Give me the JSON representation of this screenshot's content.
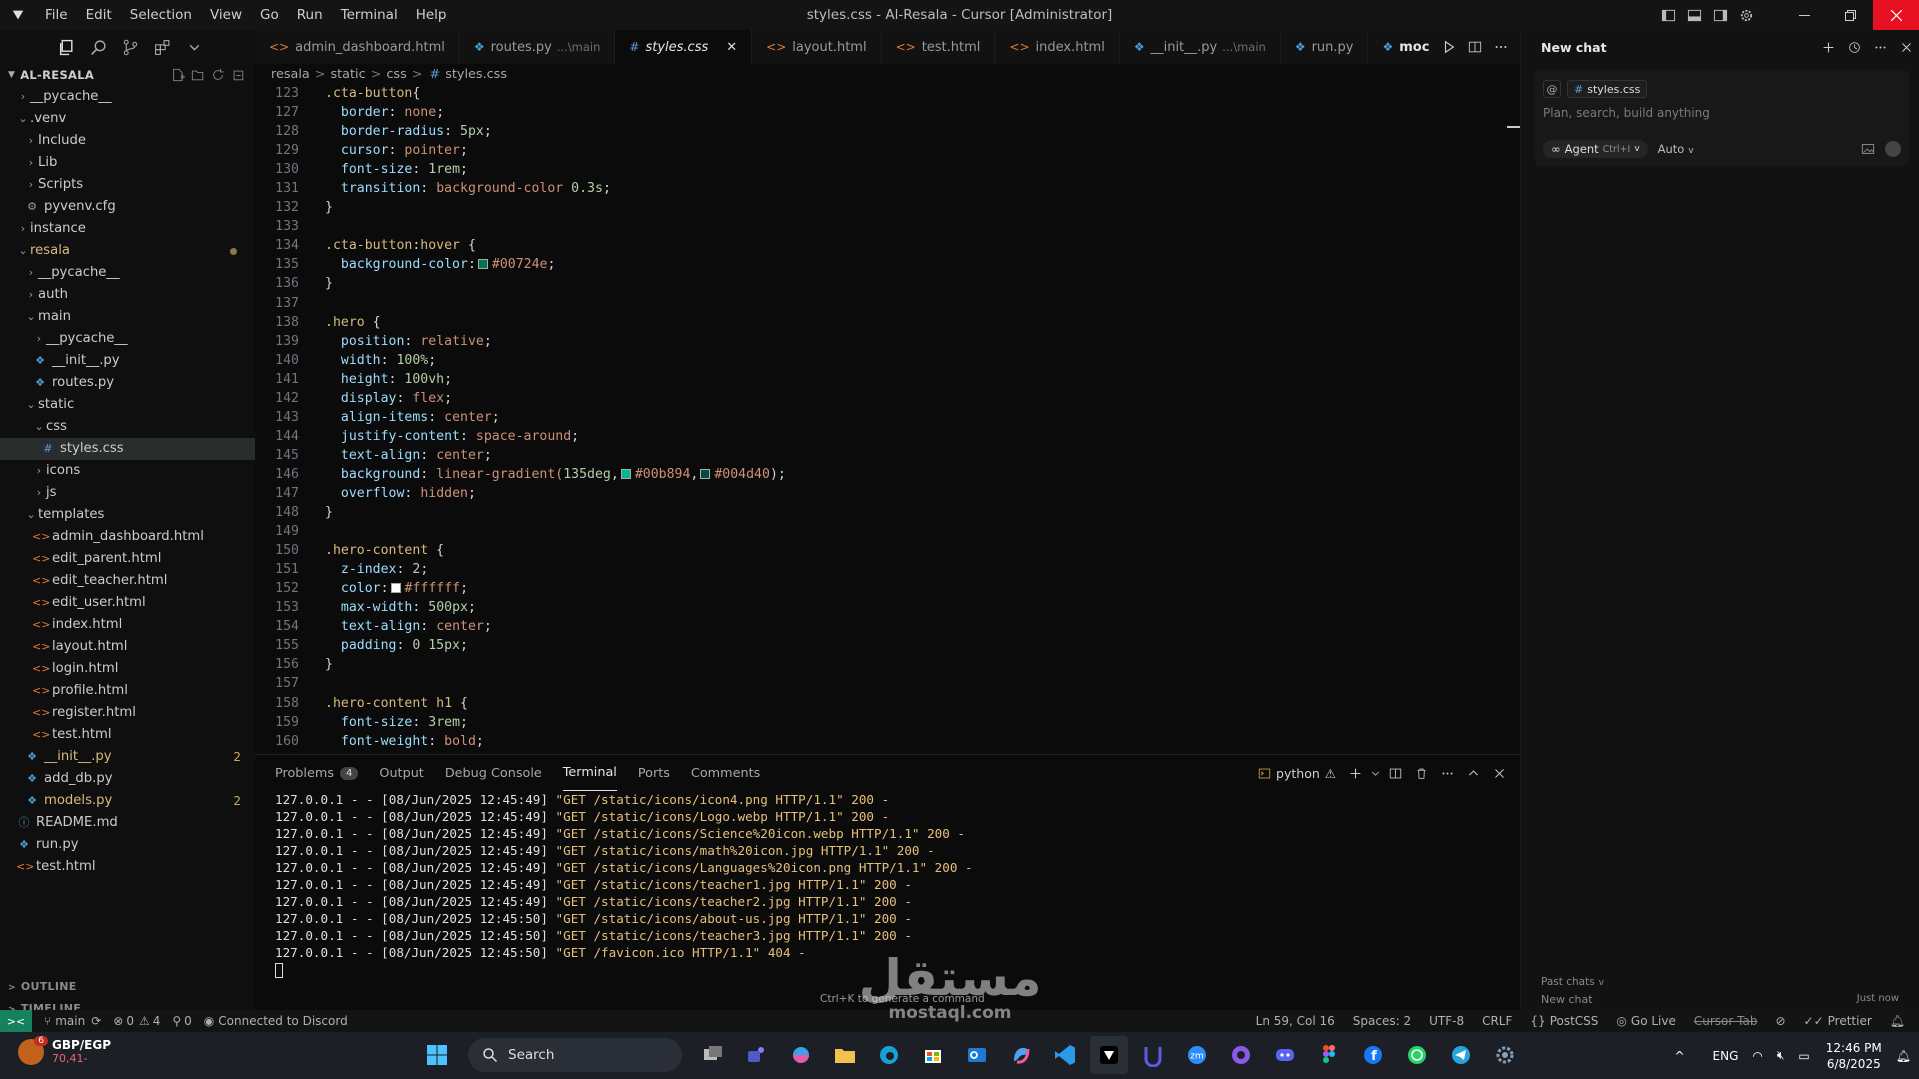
{
  "window": {
    "title": "styles.css - Al-Resala - Cursor [Administrator]"
  },
  "menu": [
    "File",
    "Edit",
    "Selection",
    "View",
    "Go",
    "Run",
    "Terminal",
    "Help"
  ],
  "explorer": {
    "root": "AL-RESALA",
    "items": [
      {
        "label": "__pycache__",
        "depth": 1,
        "kind": "folder",
        "open": false
      },
      {
        "label": ".venv",
        "depth": 1,
        "kind": "folder",
        "open": true
      },
      {
        "label": "Include",
        "depth": 2,
        "kind": "folder",
        "open": false
      },
      {
        "label": "Lib",
        "depth": 2,
        "kind": "folder",
        "open": false
      },
      {
        "label": "Scripts",
        "depth": 2,
        "kind": "folder",
        "open": false
      },
      {
        "label": "pyvenv.cfg",
        "depth": 2,
        "kind": "cfg"
      },
      {
        "label": "instance",
        "depth": 1,
        "kind": "folder",
        "open": false
      },
      {
        "label": "resala",
        "depth": 1,
        "kind": "folder",
        "open": true,
        "color": "#d7ba7d",
        "dot": true
      },
      {
        "label": "__pycache__",
        "depth": 2,
        "kind": "folder",
        "open": false
      },
      {
        "label": "auth",
        "depth": 2,
        "kind": "folder",
        "open": false
      },
      {
        "label": "main",
        "depth": 2,
        "kind": "folder",
        "open": true
      },
      {
        "label": "__pycache__",
        "depth": 3,
        "kind": "folder",
        "open": false
      },
      {
        "label": "__init__.py",
        "depth": 3,
        "kind": "py"
      },
      {
        "label": "routes.py",
        "depth": 3,
        "kind": "py"
      },
      {
        "label": "static",
        "depth": 2,
        "kind": "folder",
        "open": true
      },
      {
        "label": "css",
        "depth": 3,
        "kind": "folder",
        "open": true
      },
      {
        "label": "styles.css",
        "depth": 4,
        "kind": "css",
        "active": true
      },
      {
        "label": "icons",
        "depth": 3,
        "kind": "folder",
        "open": false
      },
      {
        "label": "js",
        "depth": 3,
        "kind": "folder",
        "open": false
      },
      {
        "label": "templates",
        "depth": 2,
        "kind": "folder",
        "open": true
      },
      {
        "label": "admin_dashboard.html",
        "depth": 3,
        "kind": "html"
      },
      {
        "label": "edit_parent.html",
        "depth": 3,
        "kind": "html"
      },
      {
        "label": "edit_teacher.html",
        "depth": 3,
        "kind": "html"
      },
      {
        "label": "edit_user.html",
        "depth": 3,
        "kind": "html"
      },
      {
        "label": "index.html",
        "depth": 3,
        "kind": "html"
      },
      {
        "label": "layout.html",
        "depth": 3,
        "kind": "html"
      },
      {
        "label": "login.html",
        "depth": 3,
        "kind": "html"
      },
      {
        "label": "profile.html",
        "depth": 3,
        "kind": "html"
      },
      {
        "label": "register.html",
        "depth": 3,
        "kind": "html"
      },
      {
        "label": "test.html",
        "depth": 3,
        "kind": "html"
      },
      {
        "label": "__init__.py",
        "depth": 2,
        "kind": "py",
        "color": "#d7ba7d",
        "badge": "2"
      },
      {
        "label": "add_db.py",
        "depth": 2,
        "kind": "py"
      },
      {
        "label": "models.py",
        "depth": 2,
        "kind": "py",
        "color": "#d7ba7d",
        "badge": "2"
      },
      {
        "label": "README.md",
        "depth": 1,
        "kind": "md"
      },
      {
        "label": "run.py",
        "depth": 1,
        "kind": "py"
      },
      {
        "label": "test.html",
        "depth": 1,
        "kind": "html"
      }
    ],
    "outline": "OUTLINE",
    "timeline": "TIMELINE"
  },
  "tabs": [
    {
      "label": "admin_dashboard.html",
      "kind": "html",
      "sub": ""
    },
    {
      "label": "routes.py",
      "kind": "py",
      "sub": "...\\main"
    },
    {
      "label": "styles.css",
      "kind": "css",
      "sub": "",
      "active": true
    },
    {
      "label": "layout.html",
      "kind": "html",
      "sub": ""
    },
    {
      "label": "test.html",
      "kind": "html",
      "sub": ""
    },
    {
      "label": "index.html",
      "kind": "html",
      "sub": ""
    },
    {
      "label": "__init__.py",
      "kind": "py",
      "sub": "...\\main"
    },
    {
      "label": "run.py",
      "kind": "py",
      "sub": ""
    },
    {
      "label": "moc",
      "kind": "py",
      "sub": ""
    }
  ],
  "breadcrumb": [
    "resala",
    "static",
    "css",
    "styles.css"
  ],
  "code": [
    {
      "n": "123",
      "t": [
        [
          "sel",
          ".cta-button"
        ],
        [
          "",
          "{"
        ]
      ]
    },
    {
      "n": "127",
      "t": [
        [
          "",
          "  "
        ],
        [
          "prop",
          "border"
        ],
        [
          "",
          ": "
        ],
        [
          "val",
          "none"
        ],
        [
          "",
          ";"
        ]
      ]
    },
    {
      "n": "128",
      "t": [
        [
          "",
          "  "
        ],
        [
          "prop",
          "border-radius"
        ],
        [
          "",
          ": "
        ],
        [
          "num",
          "5px"
        ],
        [
          "",
          ";"
        ]
      ]
    },
    {
      "n": "129",
      "t": [
        [
          "",
          "  "
        ],
        [
          "prop",
          "cursor"
        ],
        [
          "",
          ": "
        ],
        [
          "val",
          "pointer"
        ],
        [
          "",
          ";"
        ]
      ]
    },
    {
      "n": "130",
      "t": [
        [
          "",
          "  "
        ],
        [
          "prop",
          "font-size"
        ],
        [
          "",
          ": "
        ],
        [
          "num",
          "1rem"
        ],
        [
          "",
          ";"
        ]
      ]
    },
    {
      "n": "131",
      "t": [
        [
          "",
          "  "
        ],
        [
          "prop",
          "transition"
        ],
        [
          "",
          ": "
        ],
        [
          "val",
          "background-color "
        ],
        [
          "num",
          "0.3s"
        ],
        [
          "",
          ";"
        ]
      ]
    },
    {
      "n": "132",
      "t": [
        [
          "",
          "}"
        ]
      ]
    },
    {
      "n": "133",
      "t": []
    },
    {
      "n": "134",
      "t": [
        [
          "sel",
          ".cta-button"
        ],
        [
          "",
          ":"
        ],
        [
          "sel",
          "hover"
        ],
        [
          "",
          " {"
        ]
      ]
    },
    {
      "n": "135",
      "t": [
        [
          "",
          "  "
        ],
        [
          "prop",
          "background-color"
        ],
        [
          "",
          ":"
        ],
        [
          "sw",
          "#00724e"
        ],
        [
          "val",
          "#00724e"
        ],
        [
          "",
          ";"
        ]
      ]
    },
    {
      "n": "136",
      "t": [
        [
          "",
          "}"
        ]
      ]
    },
    {
      "n": "137",
      "t": []
    },
    {
      "n": "138",
      "t": [
        [
          "sel",
          ".hero"
        ],
        [
          "",
          " {"
        ]
      ]
    },
    {
      "n": "139",
      "t": [
        [
          "",
          "  "
        ],
        [
          "prop",
          "position"
        ],
        [
          "",
          ": "
        ],
        [
          "val",
          "relative"
        ],
        [
          "",
          ";"
        ]
      ]
    },
    {
      "n": "140",
      "t": [
        [
          "",
          "  "
        ],
        [
          "prop",
          "width"
        ],
        [
          "",
          ": "
        ],
        [
          "num",
          "100%"
        ],
        [
          "",
          ";"
        ]
      ]
    },
    {
      "n": "141",
      "t": [
        [
          "",
          "  "
        ],
        [
          "prop",
          "height"
        ],
        [
          "",
          ": "
        ],
        [
          "num",
          "100vh"
        ],
        [
          "",
          ";"
        ]
      ]
    },
    {
      "n": "142",
      "t": [
        [
          "",
          "  "
        ],
        [
          "prop",
          "display"
        ],
        [
          "",
          ": "
        ],
        [
          "val",
          "flex"
        ],
        [
          "",
          ";"
        ]
      ]
    },
    {
      "n": "143",
      "t": [
        [
          "",
          "  "
        ],
        [
          "prop",
          "align-items"
        ],
        [
          "",
          ": "
        ],
        [
          "val",
          "center"
        ],
        [
          "",
          ";"
        ]
      ]
    },
    {
      "n": "144",
      "t": [
        [
          "",
          "  "
        ],
        [
          "prop",
          "justify-content"
        ],
        [
          "",
          ": "
        ],
        [
          "val",
          "space-around"
        ],
        [
          "",
          ";"
        ]
      ]
    },
    {
      "n": "145",
      "t": [
        [
          "",
          "  "
        ],
        [
          "prop",
          "text-align"
        ],
        [
          "",
          ": "
        ],
        [
          "val",
          "center"
        ],
        [
          "",
          ";"
        ]
      ]
    },
    {
      "n": "146",
      "t": [
        [
          "",
          "  "
        ],
        [
          "prop",
          "background"
        ],
        [
          "",
          ": "
        ],
        [
          "val",
          "linear-gradient("
        ],
        [
          "num",
          "135deg"
        ],
        [
          "",
          ","
        ],
        [
          "sw",
          "#00b894"
        ],
        [
          "val",
          "#00b894"
        ],
        [
          "",
          ","
        ],
        [
          "sw",
          "#004d40"
        ],
        [
          "val",
          "#004d40"
        ],
        [
          "",
          ");"
        ]
      ]
    },
    {
      "n": "147",
      "t": [
        [
          "",
          "  "
        ],
        [
          "prop",
          "overflow"
        ],
        [
          "",
          ": "
        ],
        [
          "val",
          "hidden"
        ],
        [
          "",
          ";"
        ]
      ]
    },
    {
      "n": "148",
      "t": [
        [
          "",
          "}"
        ]
      ]
    },
    {
      "n": "149",
      "t": []
    },
    {
      "n": "150",
      "t": [
        [
          "sel",
          ".hero-content"
        ],
        [
          "",
          " {"
        ]
      ]
    },
    {
      "n": "151",
      "t": [
        [
          "",
          "  "
        ],
        [
          "prop",
          "z-index"
        ],
        [
          "",
          ": "
        ],
        [
          "num",
          "2"
        ],
        [
          "",
          ";"
        ]
      ]
    },
    {
      "n": "152",
      "t": [
        [
          "",
          "  "
        ],
        [
          "prop",
          "color"
        ],
        [
          "",
          ":"
        ],
        [
          "sw",
          "#ffffff"
        ],
        [
          "val",
          "#ffffff"
        ],
        [
          "",
          ";"
        ]
      ]
    },
    {
      "n": "153",
      "t": [
        [
          "",
          "  "
        ],
        [
          "prop",
          "max-width"
        ],
        [
          "",
          ": "
        ],
        [
          "num",
          "500px"
        ],
        [
          "",
          ";"
        ]
      ]
    },
    {
      "n": "154",
      "t": [
        [
          "",
          "  "
        ],
        [
          "prop",
          "text-align"
        ],
        [
          "",
          ": "
        ],
        [
          "val",
          "center"
        ],
        [
          "",
          ";"
        ]
      ]
    },
    {
      "n": "155",
      "t": [
        [
          "",
          "  "
        ],
        [
          "prop",
          "padding"
        ],
        [
          "",
          ": "
        ],
        [
          "num",
          "0 15px"
        ],
        [
          "",
          ";"
        ]
      ]
    },
    {
      "n": "156",
      "t": [
        [
          "",
          "}"
        ]
      ]
    },
    {
      "n": "157",
      "t": []
    },
    {
      "n": "158",
      "t": [
        [
          "sel",
          ".hero-content h1"
        ],
        [
          "",
          " {"
        ]
      ]
    },
    {
      "n": "159",
      "t": [
        [
          "",
          "  "
        ],
        [
          "prop",
          "font-size"
        ],
        [
          "",
          ": "
        ],
        [
          "num",
          "3rem"
        ],
        [
          "",
          ";"
        ]
      ]
    },
    {
      "n": "160",
      "t": [
        [
          "",
          "  "
        ],
        [
          "prop",
          "font-weight"
        ],
        [
          "",
          ": "
        ],
        [
          "val",
          "bold"
        ],
        [
          "",
          ";"
        ]
      ]
    }
  ],
  "panel": {
    "tabs": [
      {
        "label": "Problems",
        "badge": "4"
      },
      {
        "label": "Output"
      },
      {
        "label": "Debug Console"
      },
      {
        "label": "Terminal",
        "active": true
      },
      {
        "label": "Ports"
      },
      {
        "label": "Comments"
      }
    ],
    "terminal_name": "python",
    "lines": [
      {
        "pre": "127.0.0.1 - - [08/Jun/2025 12:45:49] ",
        "req": "\"GET /static/icons/icon4.png HTTP/1.1\" 200 -"
      },
      {
        "pre": "127.0.0.1 - - [08/Jun/2025 12:45:49] ",
        "req": "\"GET /static/icons/Logo.webp HTTP/1.1\" 200 -"
      },
      {
        "pre": "127.0.0.1 - - [08/Jun/2025 12:45:49] ",
        "req": "\"GET /static/icons/Science%20icon.webp HTTP/1.1\" 200 -"
      },
      {
        "pre": "127.0.0.1 - - [08/Jun/2025 12:45:49] ",
        "req": "\"GET /static/icons/math%20icon.jpg HTTP/1.1\" 200 -"
      },
      {
        "pre": "127.0.0.1 - - [08/Jun/2025 12:45:49] ",
        "req": "\"GET /static/icons/Languages%20icon.png HTTP/1.1\" 200 -"
      },
      {
        "pre": "127.0.0.1 - - [08/Jun/2025 12:45:49] ",
        "req": "\"GET /static/icons/teacher1.jpg HTTP/1.1\" 200 -"
      },
      {
        "pre": "127.0.0.1 - - [08/Jun/2025 12:45:49] ",
        "req": "\"GET /static/icons/teacher2.jpg HTTP/1.1\" 200 -"
      },
      {
        "pre": "127.0.0.1 - - [08/Jun/2025 12:45:50] ",
        "req": "\"GET /static/icons/about-us.jpg HTTP/1.1\" 200 -"
      },
      {
        "pre": "127.0.0.1 - - [08/Jun/2025 12:45:50] ",
        "req": "\"GET /static/icons/teacher3.jpg HTTP/1.1\" 200 -"
      },
      {
        "pre": "127.0.0.1 - - [08/Jun/2025 12:45:50] ",
        "req": "\"GET /favicon.ico HTTP/1.1\" 404 -"
      }
    ],
    "hint": "Ctrl+K to generate a command"
  },
  "chat": {
    "title": "New chat",
    "context_file": "styles.css",
    "placeholder": "Plan, search, build anything",
    "agent_label": "Agent",
    "agent_kbd": "Ctrl+I",
    "auto_label": "Auto",
    "past_chats": "Past chats",
    "history_item": "New chat",
    "history_time": "Just now"
  },
  "status": {
    "branch": "main",
    "errors": "0",
    "warnings": "4",
    "ports": "0",
    "discord": "Connected to Discord",
    "position": "Ln 59, Col 16",
    "spaces": "Spaces: 2",
    "encoding": "UTF-8",
    "eol": "CRLF",
    "language": "PostCSS",
    "golive": "Go Live",
    "cursor_tab": "Cursor Tab",
    "prettier": "Prettier"
  },
  "taskbar": {
    "weather_title": "GBP/EGP",
    "weather_sub": "70,41-",
    "weather_badge": "6",
    "search": "Search",
    "lang": "ENG",
    "time": "12:46 PM",
    "date": "6/8/2025"
  },
  "watermark": {
    "big": "مستقل",
    "small": "mostaql.com"
  },
  "colors": {
    "accent": "#16825d",
    "close": "#e81123",
    "selector": "#d7ba7d",
    "property": "#9cdcfe",
    "value": "#ce9178",
    "number": "#b5cea8"
  }
}
